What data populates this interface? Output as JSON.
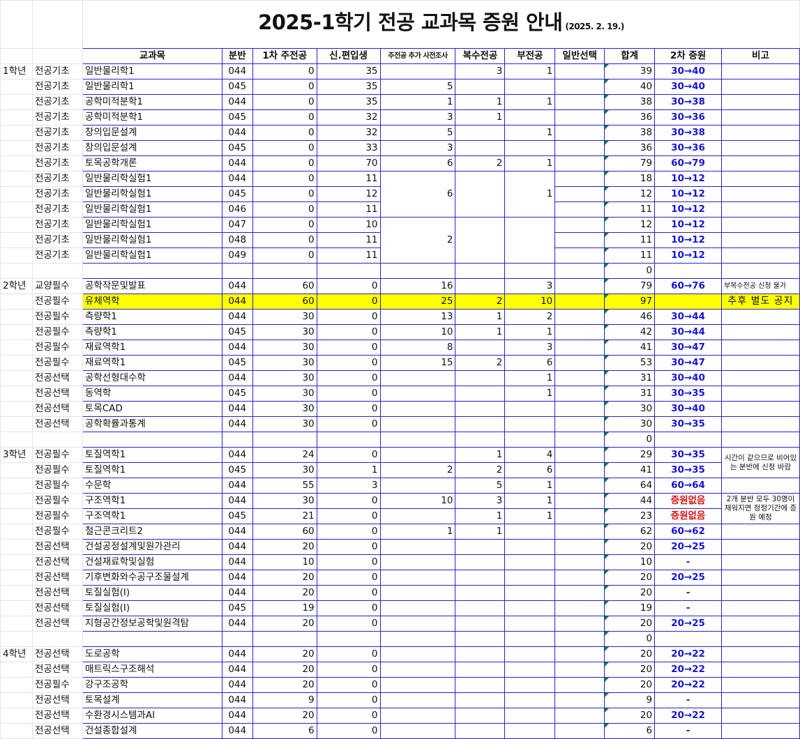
{
  "title": "2025-1학기 전공 교과목 증원 안내",
  "date": "(2025. 2. 19.)",
  "headers": [
    "교과목",
    "분반",
    "1차 주전공",
    "신.편입생",
    "주전공 추가 사전조사",
    "복수전공",
    "부전공",
    "일반선택",
    "합계",
    "2차 증원",
    "비고"
  ],
  "years": {
    "y1": "1학년",
    "y2": "2학년",
    "y3": "3학년",
    "y4": "4학년"
  },
  "blank_totals": [
    "0",
    "0",
    "0"
  ],
  "rows": [
    {
      "cat": "전공기초",
      "course": "일반물리학1",
      "sec": "044",
      "first": "0",
      "trans": "35",
      "pre": "",
      "dbl": "3",
      "minor": "1",
      "gen": "",
      "total": "39",
      "inc": "30→40"
    },
    {
      "cat": "전공기초",
      "course": "일반물리학1",
      "sec": "045",
      "first": "0",
      "trans": "35",
      "pre": "5",
      "dbl": "",
      "minor": "",
      "gen": "",
      "total": "40",
      "inc": "30→40"
    },
    {
      "cat": "전공기초",
      "course": "공학미적분학1",
      "sec": "044",
      "first": "0",
      "trans": "35",
      "pre": "1",
      "dbl": "1",
      "minor": "1",
      "gen": "",
      "total": "38",
      "inc": "30→38"
    },
    {
      "cat": "전공기초",
      "course": "공학미적분학1",
      "sec": "045",
      "first": "0",
      "trans": "32",
      "pre": "3",
      "dbl": "1",
      "minor": "",
      "gen": "",
      "total": "36",
      "inc": "30→36"
    },
    {
      "cat": "전공기초",
      "course": "창의입문설계",
      "sec": "044",
      "first": "0",
      "trans": "32",
      "pre": "5",
      "dbl": "",
      "minor": "1",
      "gen": "",
      "total": "38",
      "inc": "30→38"
    },
    {
      "cat": "전공기초",
      "course": "창의입문설계",
      "sec": "045",
      "first": "0",
      "trans": "33",
      "pre": "3",
      "dbl": "",
      "minor": "",
      "gen": "",
      "total": "36",
      "inc": "30→36"
    },
    {
      "cat": "전공기초",
      "course": "토목공학개론",
      "sec": "044",
      "first": "0",
      "trans": "70",
      "pre": "6",
      "dbl": "2",
      "minor": "1",
      "gen": "",
      "total": "79",
      "inc": "60→79"
    },
    {
      "cat": "전공기초",
      "course": "일반물리학실험1",
      "sec": "044",
      "first": "0",
      "trans": "11",
      "total": "18",
      "inc": "10→12"
    },
    {
      "cat": "전공기초",
      "course": "일반물리학실험1",
      "sec": "045",
      "first": "0",
      "trans": "12",
      "total": "12",
      "inc": "10→12"
    },
    {
      "cat": "전공기초",
      "course": "일반물리학실험1",
      "sec": "046",
      "first": "0",
      "trans": "11",
      "total": "11",
      "inc": "10→12"
    },
    {
      "cat": "전공기초",
      "course": "일반물리학실험1",
      "sec": "047",
      "first": "0",
      "trans": "10",
      "total": "12",
      "inc": "10→12"
    },
    {
      "cat": "전공기초",
      "course": "일반물리학실험1",
      "sec": "048",
      "first": "0",
      "trans": "11",
      "total": "11",
      "inc": "10→12"
    },
    {
      "cat": "전공기초",
      "course": "일반물리학실험1",
      "sec": "049",
      "first": "0",
      "trans": "11",
      "total": "11",
      "inc": "10→12"
    },
    {
      "cat": "교양필수",
      "course": "공학작문및발표",
      "sec": "044",
      "first": "60",
      "trans": "0",
      "pre": "16",
      "dbl": "",
      "minor": "3",
      "gen": "",
      "total": "79",
      "inc": "60→76",
      "note": "부복수전공 신청 불가"
    },
    {
      "cat": "전공필수",
      "course": "유체역학",
      "sec": "044",
      "first": "60",
      "trans": "0",
      "pre": "25",
      "dbl": "2",
      "minor": "10",
      "gen": "",
      "total": "97",
      "inc": "",
      "note": "추후 별도 공지"
    },
    {
      "cat": "전공필수",
      "course": "측량학1",
      "sec": "044",
      "first": "30",
      "trans": "0",
      "pre": "13",
      "dbl": "1",
      "minor": "2",
      "gen": "",
      "total": "46",
      "inc": "30→44"
    },
    {
      "cat": "전공필수",
      "course": "측량학1",
      "sec": "045",
      "first": "30",
      "trans": "0",
      "pre": "10",
      "dbl": "1",
      "minor": "1",
      "gen": "",
      "total": "42",
      "inc": "30→44"
    },
    {
      "cat": "전공필수",
      "course": "재료역학1",
      "sec": "044",
      "first": "30",
      "trans": "0",
      "pre": "8",
      "dbl": "",
      "minor": "3",
      "gen": "",
      "total": "41",
      "inc": "30→47"
    },
    {
      "cat": "전공필수",
      "course": "재료역학1",
      "sec": "045",
      "first": "30",
      "trans": "0",
      "pre": "15",
      "dbl": "2",
      "minor": "6",
      "gen": "",
      "total": "53",
      "inc": "30→47"
    },
    {
      "cat": "전공선택",
      "course": "공학선형대수학",
      "sec": "044",
      "first": "30",
      "trans": "0",
      "pre": "",
      "dbl": "",
      "minor": "1",
      "gen": "",
      "total": "31",
      "inc": "30→40"
    },
    {
      "cat": "전공선택",
      "course": "동역학",
      "sec": "045",
      "first": "30",
      "trans": "0",
      "pre": "",
      "dbl": "",
      "minor": "1",
      "gen": "",
      "total": "31",
      "inc": "30→35"
    },
    {
      "cat": "전공선택",
      "course": "토목CAD",
      "sec": "044",
      "first": "30",
      "trans": "0",
      "pre": "",
      "dbl": "",
      "minor": "",
      "gen": "",
      "total": "30",
      "inc": "30→40"
    },
    {
      "cat": "전공선택",
      "course": "공학확률과통계",
      "sec": "044",
      "first": "30",
      "trans": "0",
      "pre": "",
      "dbl": "",
      "minor": "",
      "gen": "",
      "total": "30",
      "inc": "30→35"
    },
    {
      "cat": "전공필수",
      "course": "토질역학1",
      "sec": "044",
      "first": "24",
      "trans": "0",
      "pre": "",
      "dbl": "1",
      "minor": "4",
      "gen": "",
      "total": "29",
      "inc": "30→35"
    },
    {
      "cat": "전공필수",
      "course": "토질역학1",
      "sec": "045",
      "first": "30",
      "trans": "1",
      "pre": "2",
      "dbl": "2",
      "minor": "6",
      "gen": "",
      "total": "41",
      "inc": "30→35"
    },
    {
      "cat": "전공필수",
      "course": "수문학",
      "sec": "044",
      "first": "55",
      "trans": "3",
      "pre": "",
      "dbl": "5",
      "minor": "1",
      "gen": "",
      "total": "64",
      "inc": "60→64"
    },
    {
      "cat": "전공필수",
      "course": "구조역학1",
      "sec": "044",
      "first": "30",
      "trans": "0",
      "pre": "10",
      "dbl": "3",
      "minor": "1",
      "gen": "",
      "total": "44",
      "inc": "증원없음"
    },
    {
      "cat": "전공필수",
      "course": "구조역학1",
      "sec": "045",
      "first": "21",
      "trans": "0",
      "pre": "",
      "dbl": "1",
      "minor": "1",
      "gen": "",
      "total": "23",
      "inc": "증원없음"
    },
    {
      "cat": "전공필수",
      "course": "철근콘크리트2",
      "sec": "044",
      "first": "60",
      "trans": "0",
      "pre": "1",
      "dbl": "1",
      "minor": "",
      "gen": "",
      "total": "62",
      "inc": "60→62"
    },
    {
      "cat": "전공선택",
      "course": "건설공정설계및원가관리",
      "sec": "044",
      "first": "20",
      "trans": "0",
      "pre": "",
      "dbl": "",
      "minor": "",
      "gen": "",
      "total": "20",
      "inc": "20→25"
    },
    {
      "cat": "전공선택",
      "course": "건설재료학및실험",
      "sec": "044",
      "first": "10",
      "trans": "0",
      "pre": "",
      "dbl": "",
      "minor": "",
      "gen": "",
      "total": "10",
      "inc": "-"
    },
    {
      "cat": "전공선택",
      "course": "기후변화와수공구조물설계",
      "sec": "044",
      "first": "20",
      "trans": "0",
      "pre": "",
      "dbl": "",
      "minor": "",
      "gen": "",
      "total": "20",
      "inc": "20→25"
    },
    {
      "cat": "전공선택",
      "course": "토질실험(I)",
      "sec": "044",
      "first": "20",
      "trans": "0",
      "pre": "",
      "dbl": "",
      "minor": "",
      "gen": "",
      "total": "20",
      "inc": "-"
    },
    {
      "cat": "전공선택",
      "course": "토질실험(I)",
      "sec": "045",
      "first": "19",
      "trans": "0",
      "pre": "",
      "dbl": "",
      "minor": "",
      "gen": "",
      "total": "19",
      "inc": "-"
    },
    {
      "cat": "전공선택",
      "course": "지형공간정보공학및원격탐",
      "sec": "044",
      "first": "20",
      "trans": "0",
      "pre": "",
      "dbl": "",
      "minor": "",
      "gen": "",
      "total": "20",
      "inc": "20→25"
    },
    {
      "cat": "전공선택",
      "course": "도로공학",
      "sec": "044",
      "first": "20",
      "trans": "0",
      "pre": "",
      "dbl": "",
      "minor": "",
      "gen": "",
      "total": "20",
      "inc": "20→22"
    },
    {
      "cat": "전공선택",
      "course": "매트릭스구조해석",
      "sec": "044",
      "first": "20",
      "trans": "0",
      "pre": "",
      "dbl": "",
      "minor": "",
      "gen": "",
      "total": "20",
      "inc": "20→22"
    },
    {
      "cat": "전공필수",
      "course": "강구조공학",
      "sec": "044",
      "first": "20",
      "trans": "0",
      "pre": "",
      "dbl": "",
      "minor": "",
      "gen": "",
      "total": "20",
      "inc": "20→22"
    },
    {
      "cat": "전공선택",
      "course": "토목설계",
      "sec": "044",
      "first": "9",
      "trans": "0",
      "pre": "",
      "dbl": "",
      "minor": "",
      "gen": "",
      "total": "9",
      "inc": "-"
    },
    {
      "cat": "전공선택",
      "course": "수환경시스템과AI",
      "sec": "044",
      "first": "20",
      "trans": "0",
      "pre": "",
      "dbl": "",
      "minor": "",
      "gen": "",
      "total": "20",
      "inc": "20→22"
    },
    {
      "cat": "전공선택",
      "course": "건설종합설계",
      "sec": "044",
      "first": "6",
      "trans": "0",
      "pre": "",
      "dbl": "",
      "minor": "",
      "gen": "",
      "total": "6",
      "inc": "-"
    }
  ],
  "merged": {
    "lab_pre_a": "6",
    "lab_minor_a": "1",
    "lab_pre_b": "2"
  },
  "notes": {
    "soil": "시간이 같으므로 비어있는 분반에 신청 바람",
    "struct": "2개 분반 모두 30명이 채워지면 정정기간에 증원 예정"
  }
}
